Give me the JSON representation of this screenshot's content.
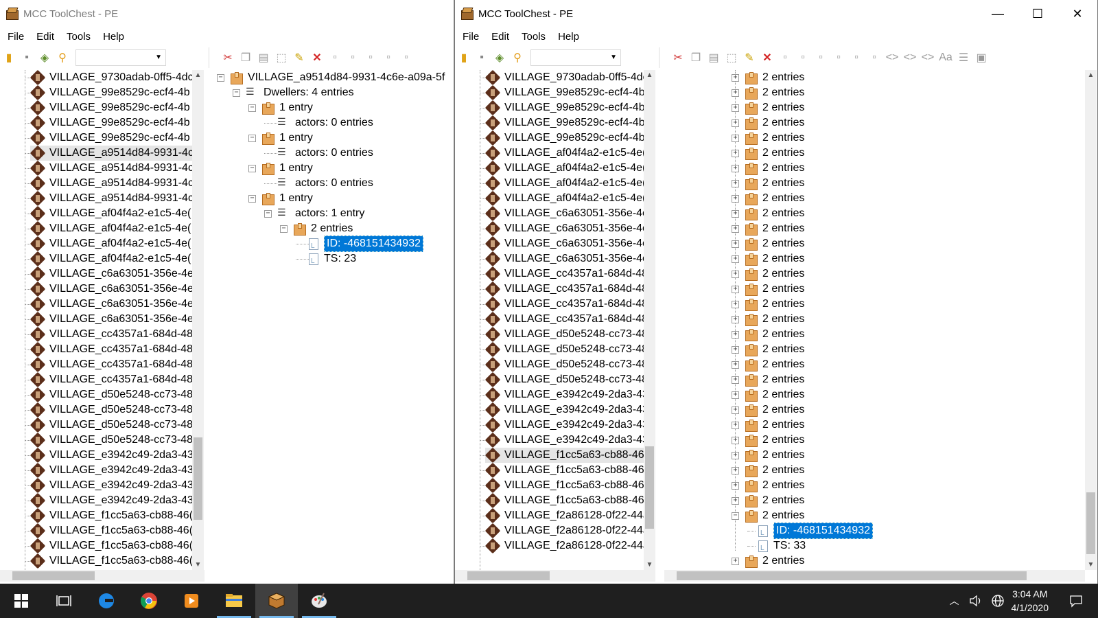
{
  "left_window": {
    "title": "MCC ToolChest - PE",
    "menu": [
      "File",
      "Edit",
      "Tools",
      "Help"
    ],
    "list": [
      "VILLAGE_9730adab-0ff5-4dc",
      "VILLAGE_99e8529c-ecf4-4b",
      "VILLAGE_99e8529c-ecf4-4b",
      "VILLAGE_99e8529c-ecf4-4b",
      "VILLAGE_99e8529c-ecf4-4b",
      "VILLAGE_a9514d84-9931-4c",
      "VILLAGE_a9514d84-9931-4c",
      "VILLAGE_a9514d84-9931-4c",
      "VILLAGE_a9514d84-9931-4c",
      "VILLAGE_af04f4a2-e1c5-4e(",
      "VILLAGE_af04f4a2-e1c5-4e(",
      "VILLAGE_af04f4a2-e1c5-4e(",
      "VILLAGE_af04f4a2-e1c5-4e(",
      "VILLAGE_c6a63051-356e-4e",
      "VILLAGE_c6a63051-356e-4e",
      "VILLAGE_c6a63051-356e-4e",
      "VILLAGE_c6a63051-356e-4e",
      "VILLAGE_cc4357a1-684d-48",
      "VILLAGE_cc4357a1-684d-48",
      "VILLAGE_cc4357a1-684d-48",
      "VILLAGE_cc4357a1-684d-48",
      "VILLAGE_d50e5248-cc73-48",
      "VILLAGE_d50e5248-cc73-48",
      "VILLAGE_d50e5248-cc73-48",
      "VILLAGE_d50e5248-cc73-48",
      "VILLAGE_e3942c49-2da3-43",
      "VILLAGE_e3942c49-2da3-43",
      "VILLAGE_e3942c49-2da3-43",
      "VILLAGE_e3942c49-2da3-43",
      "VILLAGE_f1cc5a63-cb88-46(",
      "VILLAGE_f1cc5a63-cb88-46(",
      "VILLAGE_f1cc5a63-cb88-46(",
      "VILLAGE_f1cc5a63-cb88-46("
    ],
    "tree": {
      "root": "VILLAGE_a9514d84-9931-4c6e-a09a-5f",
      "dwellers": "Dwellers: 4 entries",
      "entry": "1 entry",
      "actors0": "actors: 0 entries",
      "actors1": "actors: 1 entry",
      "two_entries": "2 entries",
      "id": "ID: -468151434932",
      "ts": "TS: 23"
    }
  },
  "right_window": {
    "title": "MCC ToolChest - PE",
    "menu": [
      "File",
      "Edit",
      "Tools",
      "Help"
    ],
    "list": [
      "VILLAGE_9730adab-0ff5-4dc",
      "VILLAGE_99e8529c-ecf4-4b",
      "VILLAGE_99e8529c-ecf4-4b",
      "VILLAGE_99e8529c-ecf4-4b",
      "VILLAGE_99e8529c-ecf4-4b",
      "VILLAGE_af04f4a2-e1c5-4e(",
      "VILLAGE_af04f4a2-e1c5-4e(",
      "VILLAGE_af04f4a2-e1c5-4e(",
      "VILLAGE_af04f4a2-e1c5-4e(",
      "VILLAGE_c6a63051-356e-4e",
      "VILLAGE_c6a63051-356e-4e",
      "VILLAGE_c6a63051-356e-4e",
      "VILLAGE_c6a63051-356e-4e",
      "VILLAGE_cc4357a1-684d-48",
      "VILLAGE_cc4357a1-684d-48",
      "VILLAGE_cc4357a1-684d-48",
      "VILLAGE_cc4357a1-684d-48",
      "VILLAGE_d50e5248-cc73-48",
      "VILLAGE_d50e5248-cc73-48",
      "VILLAGE_d50e5248-cc73-48",
      "VILLAGE_d50e5248-cc73-48",
      "VILLAGE_e3942c49-2da3-43",
      "VILLAGE_e3942c49-2da3-43",
      "VILLAGE_e3942c49-2da3-43",
      "VILLAGE_e3942c49-2da3-43",
      "VILLAGE_f1cc5a63-cb88-46(",
      "VILLAGE_f1cc5a63-cb88-46(",
      "VILLAGE_f1cc5a63-cb88-46(",
      "VILLAGE_f1cc5a63-cb88-46(",
      "VILLAGE_f2a86128-0f22-44a",
      "VILLAGE_f2a86128-0f22-44a",
      "VILLAGE_f2a86128-0f22-44a"
    ],
    "tree": {
      "entries_label": "2 entries",
      "collapsed_count": 29,
      "id": "ID: -468151434932",
      "ts": "TS: 33"
    }
  },
  "taskbar": {
    "time": "3:04 AM",
    "date": "4/1/2020"
  },
  "colors": {
    "selection": "#0078d7",
    "taskbar": "#1f1f1f"
  }
}
